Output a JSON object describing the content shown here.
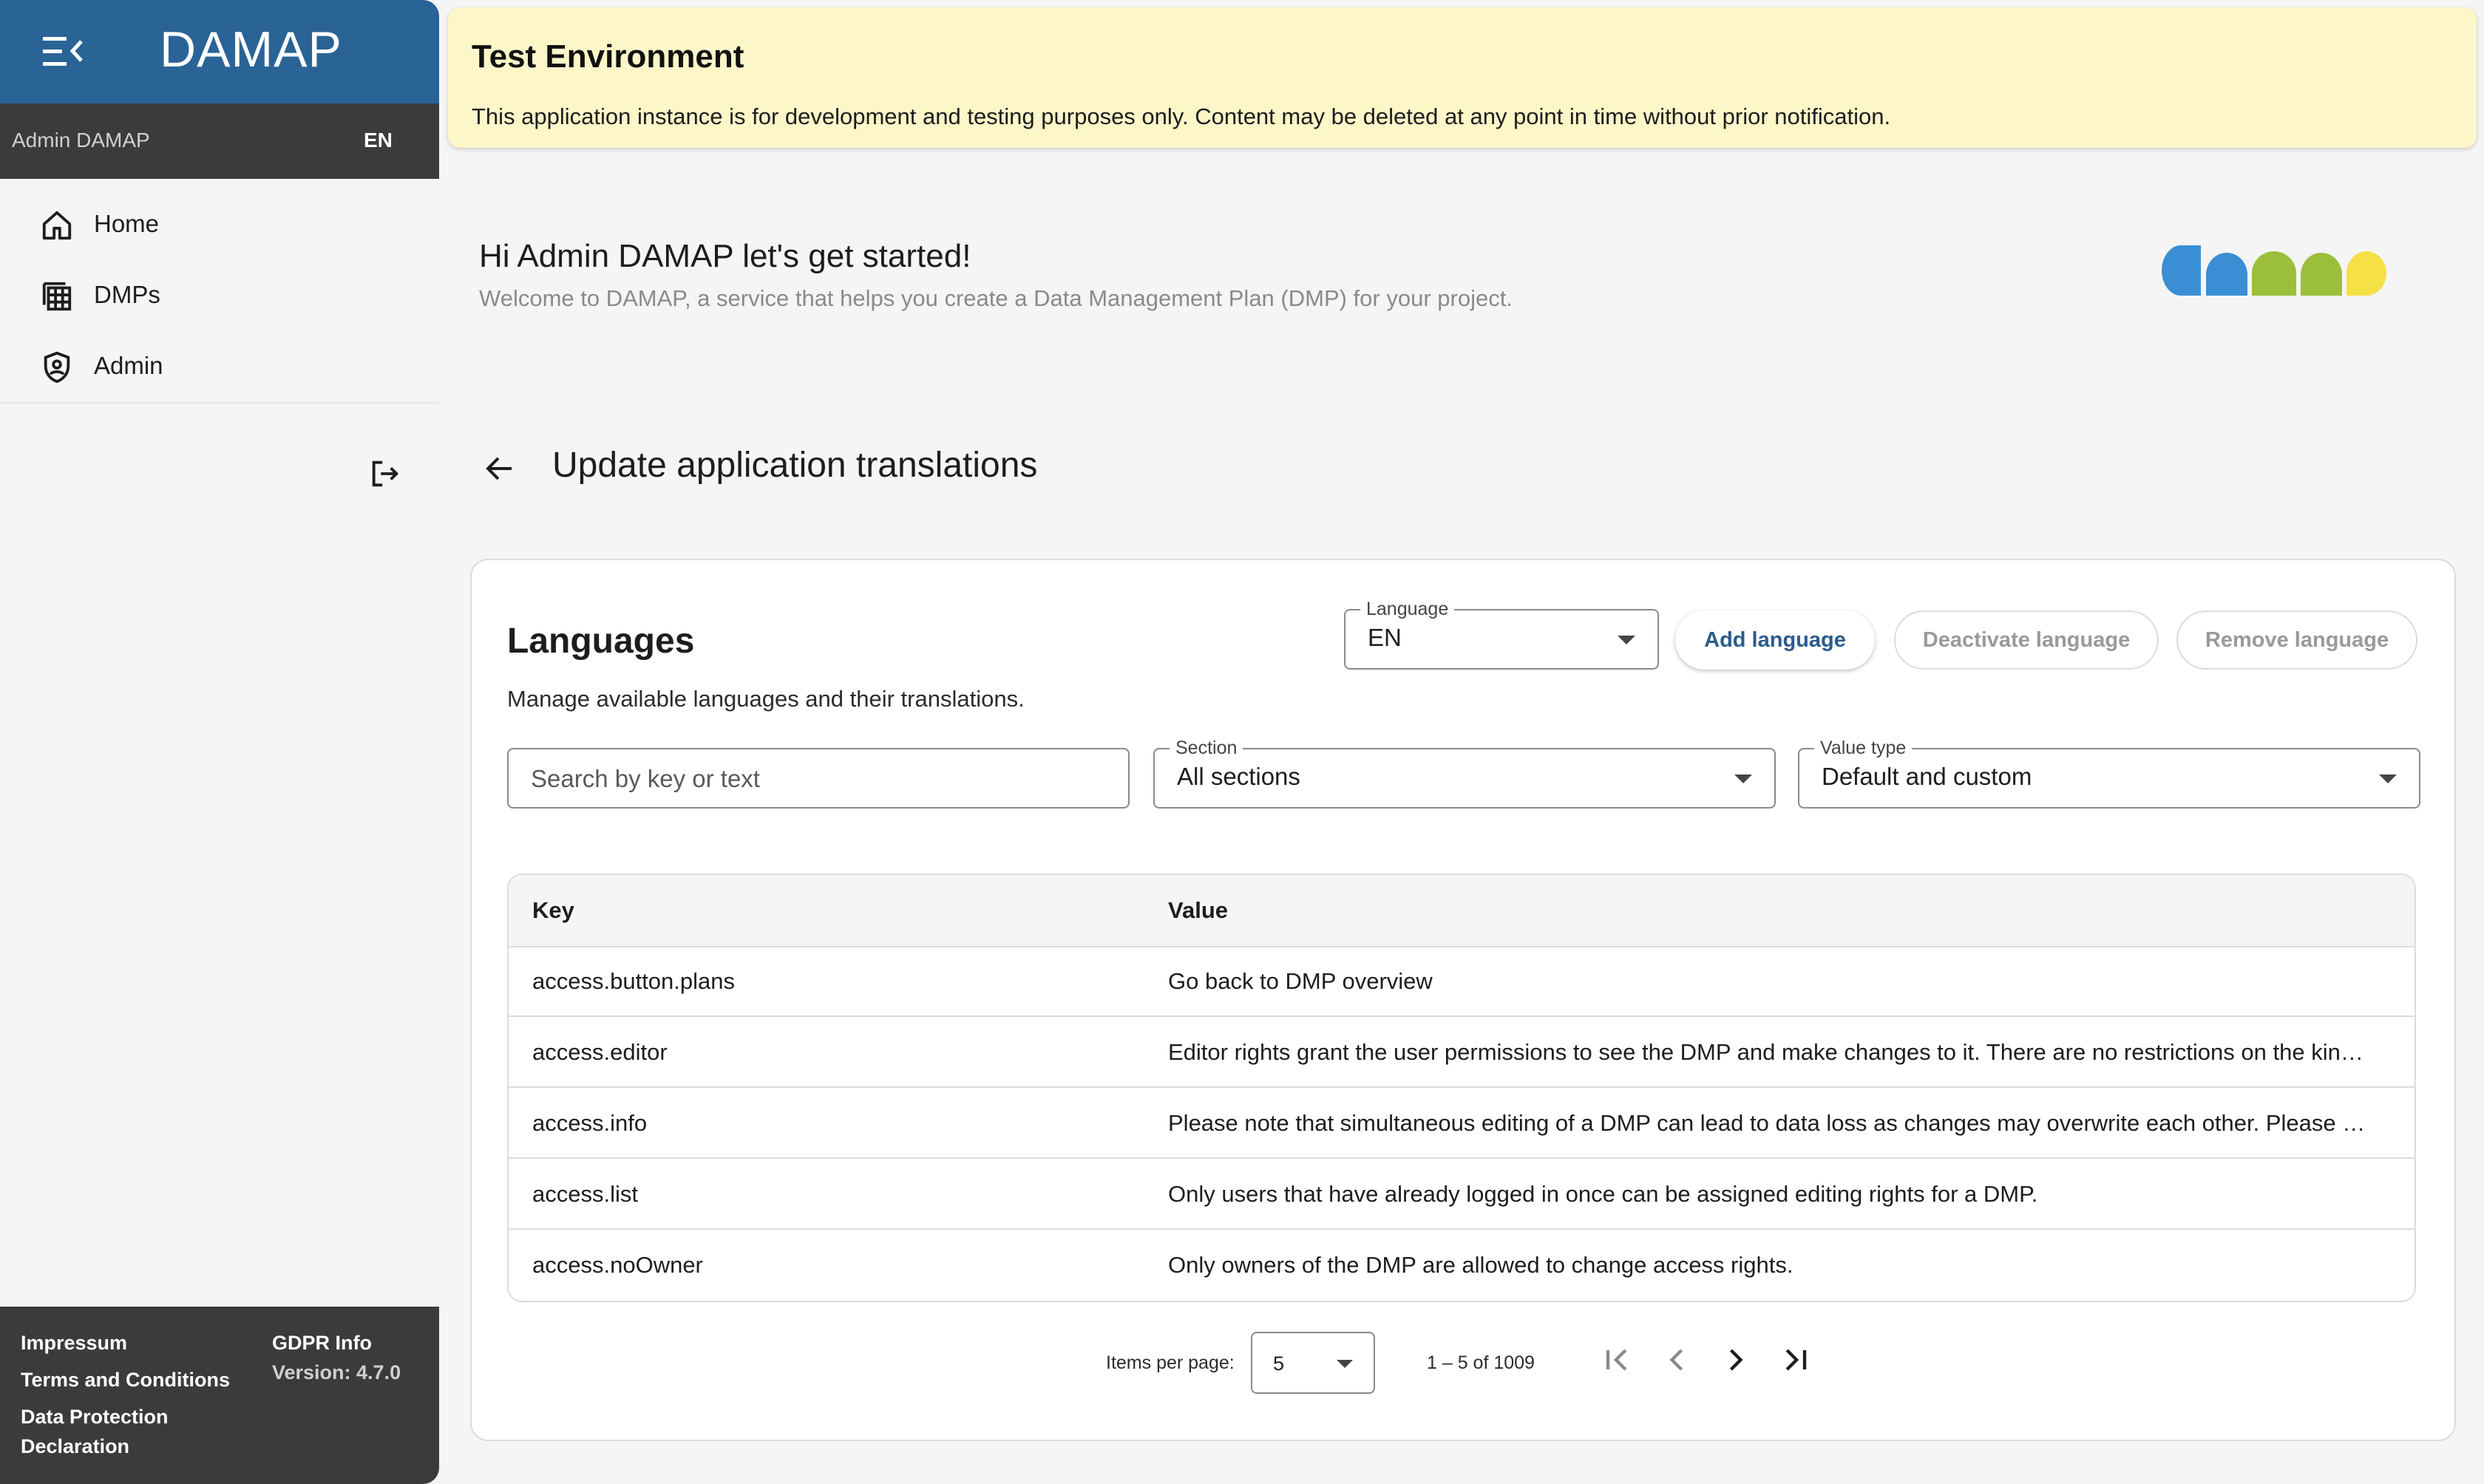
{
  "app": {
    "brand": "DAMAP"
  },
  "user": {
    "name": "Admin DAMAP",
    "language": "EN"
  },
  "sidebar": {
    "items": [
      {
        "label": "Home",
        "icon": "home-icon"
      },
      {
        "label": "DMPs",
        "icon": "table-icon"
      },
      {
        "label": "Admin",
        "icon": "shield-icon"
      }
    ]
  },
  "footer": {
    "impressum": "Impressum",
    "terms": "Terms and Conditions",
    "data_protection_1": "Data Protection",
    "data_protection_2": "Declaration",
    "gdpr": "GDPR Info",
    "version": "Version: 4.7.0"
  },
  "banner": {
    "title": "Test Environment",
    "message": "This application instance is for development and testing purposes only. Content may be deleted at any point in time without prior notification."
  },
  "welcome": {
    "title": "Hi Admin DAMAP let's get started!",
    "subtitle": "Welcome to DAMAP, a service that helps you create a Data Management Plan (DMP) for your project."
  },
  "page": {
    "title": "Update application translations"
  },
  "languages": {
    "heading": "Languages",
    "description": "Manage available languages and their translations.",
    "language_label": "Language",
    "language_value": "EN",
    "add_label": "Add language",
    "deactivate_label": "Deactivate language",
    "remove_label": "Remove language"
  },
  "filters": {
    "search_placeholder": "Search by key or text",
    "section_label": "Section",
    "section_value": "All sections",
    "value_type_label": "Value type",
    "value_type_value": "Default and custom"
  },
  "table": {
    "columns": [
      "Key",
      "Value"
    ],
    "rows": [
      {
        "key": "access.button.plans",
        "value": "Go back to DMP overview"
      },
      {
        "key": "access.editor",
        "value": "Editor rights grant the user permissions to see the DMP and make changes to it. There are no restrictions on the kin…"
      },
      {
        "key": "access.info",
        "value": "Please note that simultaneous editing of a DMP can lead to data loss as changes may overwrite each other. Please …"
      },
      {
        "key": "access.list",
        "value": "Only users that have already logged in once can be assigned editing rights for a DMP."
      },
      {
        "key": "access.noOwner",
        "value": "Only owners of the DMP are allowed to change access rights."
      }
    ]
  },
  "paginator": {
    "items_label": "Items per page:",
    "page_size": "5",
    "range": "1 – 5 of 1009"
  },
  "colors": {
    "primary": "#2a6396",
    "dark": "#3a3b3c",
    "banner_bg": "#fdf6c9",
    "logo_blue": "#3a8fd4",
    "logo_green": "#9bbf3a",
    "logo_yellow": "#f5e046"
  }
}
